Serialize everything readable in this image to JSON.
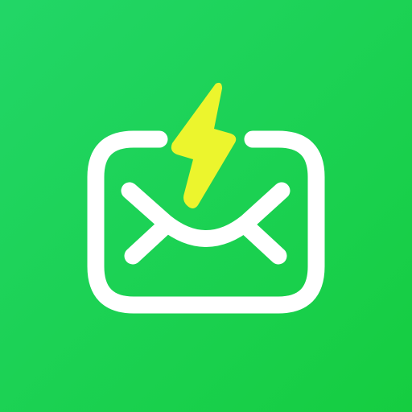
{
  "icon": {
    "name": "mail-with-lightning-bolt",
    "colors": {
      "background_start": "#22d667",
      "background_end": "#17cf45",
      "stroke": "#ffffff",
      "bolt": "#ecf52d"
    }
  }
}
